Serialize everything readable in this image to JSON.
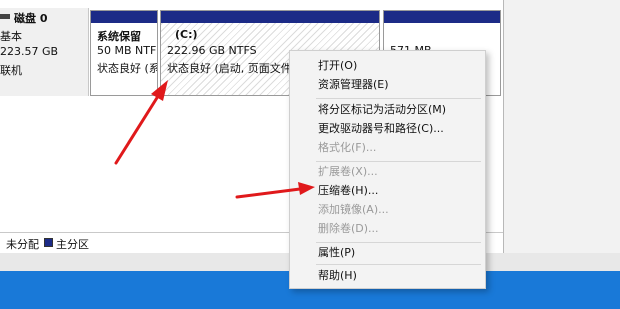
{
  "disk": {
    "title": "磁盘 0",
    "type": "基本",
    "size": "223.57 GB",
    "status": "联机"
  },
  "partitions": [
    {
      "name": "系统保留",
      "size": "50 MB NTF",
      "status": "状态良好 (系"
    },
    {
      "name": "(C:)",
      "size": "222.96 GB NTFS",
      "status": "状态良好 (启动, 页面文件,"
    },
    {
      "name": "",
      "size": "571 MB",
      "status": ""
    }
  ],
  "legend": {
    "unallocated": "未分配",
    "primary": "主分区"
  },
  "context_menu": {
    "items": [
      {
        "label": "打开(O)",
        "disabled": false
      },
      {
        "label": "资源管理器(E)",
        "disabled": false
      },
      {
        "label": "将分区标记为活动分区(M)",
        "disabled": false
      },
      {
        "label": "更改驱动器号和路径(C)...",
        "disabled": false
      },
      {
        "label": "格式化(F)...",
        "disabled": true
      },
      {
        "label": "扩展卷(X)...",
        "disabled": true
      },
      {
        "label": "压缩卷(H)...",
        "disabled": false
      },
      {
        "label": "添加镜像(A)...",
        "disabled": true
      },
      {
        "label": "删除卷(D)...",
        "disabled": true
      },
      {
        "label": "属性(P)",
        "disabled": false
      },
      {
        "label": "帮助(H)",
        "disabled": false
      }
    ]
  },
  "colors": {
    "partition_header": "#1c2b87",
    "arrow": "#e0191b",
    "taskbar": "#1979d8"
  },
  "annotations": [
    {
      "icon": "red-arrow-icon",
      "target": "partition-c"
    },
    {
      "icon": "red-arrow-icon",
      "target": "menu-item-shrink-volume"
    }
  ]
}
